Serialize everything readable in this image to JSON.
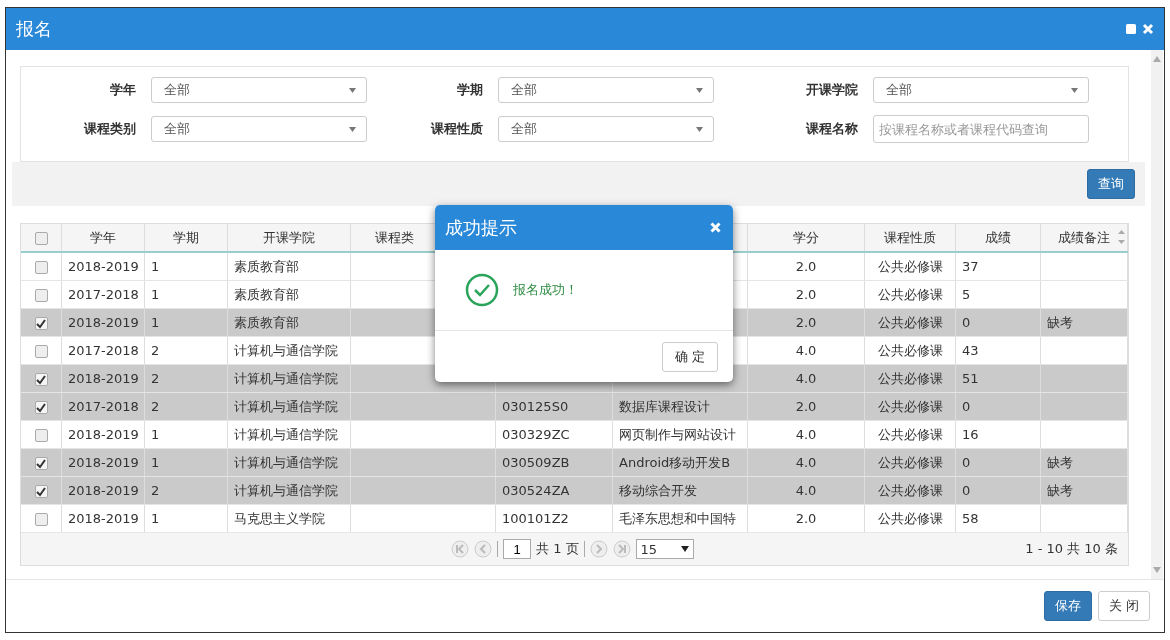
{
  "window": {
    "title": "报名"
  },
  "filters": [
    {
      "label": "学年",
      "kind": "select",
      "value": "全部"
    },
    {
      "label": "学期",
      "kind": "select",
      "value": "全部"
    },
    {
      "label": "开课学院",
      "kind": "select",
      "value": "全部"
    },
    {
      "label": "课程类别",
      "kind": "select",
      "value": "全部"
    },
    {
      "label": "课程性质",
      "kind": "select",
      "value": "全部"
    },
    {
      "label": "课程名称",
      "kind": "text",
      "placeholder": "按课程名称或者课程代码查询"
    }
  ],
  "query_button": "查询",
  "table": {
    "all_checked": false,
    "columns": [
      "学年",
      "学期",
      "开课学院",
      "课程类",
      "",
      "",
      "学分",
      "课程性质",
      "成绩",
      "成绩备注"
    ],
    "rows": [
      {
        "selected": false,
        "cells": [
          "2018-2019",
          "1",
          "素质教育部",
          "",
          "",
          "",
          "2.0",
          "公共必修课",
          "37",
          ""
        ]
      },
      {
        "selected": false,
        "cells": [
          "2017-2018",
          "1",
          "素质教育部",
          "",
          "",
          "",
          "2.0",
          "公共必修课",
          "5",
          ""
        ]
      },
      {
        "selected": true,
        "cells": [
          "2018-2019",
          "1",
          "素质教育部",
          "",
          "",
          "",
          "2.0",
          "公共必修课",
          "0",
          "缺考"
        ]
      },
      {
        "selected": false,
        "cells": [
          "2017-2018",
          "2",
          "计算机与通信学院",
          "",
          "",
          "",
          "4.0",
          "公共必修课",
          "43",
          ""
        ]
      },
      {
        "selected": true,
        "cells": [
          "2018-2019",
          "2",
          "计算机与通信学院",
          "",
          "",
          "",
          "4.0",
          "公共必修课",
          "51",
          ""
        ]
      },
      {
        "selected": true,
        "cells": [
          "2017-2018",
          "2",
          "计算机与通信学院",
          "",
          "030125S0",
          "数据库课程设计",
          "2.0",
          "公共必修课",
          "0",
          ""
        ]
      },
      {
        "selected": false,
        "cells": [
          "2018-2019",
          "1",
          "计算机与通信学院",
          "",
          "030329ZC",
          "网页制作与网站设计",
          "4.0",
          "公共必修课",
          "16",
          ""
        ]
      },
      {
        "selected": true,
        "cells": [
          "2018-2019",
          "1",
          "计算机与通信学院",
          "",
          "030509ZB",
          "Android移动开发B",
          "4.0",
          "公共必修课",
          "0",
          "缺考"
        ]
      },
      {
        "selected": true,
        "cells": [
          "2018-2019",
          "2",
          "计算机与通信学院",
          "",
          "030524ZA",
          "移动综合开发",
          "4.0",
          "公共必修课",
          "0",
          "缺考"
        ]
      },
      {
        "selected": false,
        "cells": [
          "2018-2019",
          "1",
          "马克思主义学院",
          "",
          "100101Z2",
          "毛泽东思想和中国特",
          "2.0",
          "公共必修课",
          "58",
          ""
        ]
      }
    ]
  },
  "pager": {
    "page": "1",
    "total_pages": "共 1 页",
    "page_size": "15",
    "summary": "1 - 10   共 10 条"
  },
  "buttons": {
    "save": "保存",
    "close": "关 闭"
  },
  "dialog": {
    "title": "成功提示",
    "message": "报名成功！",
    "ok": "确 定"
  }
}
